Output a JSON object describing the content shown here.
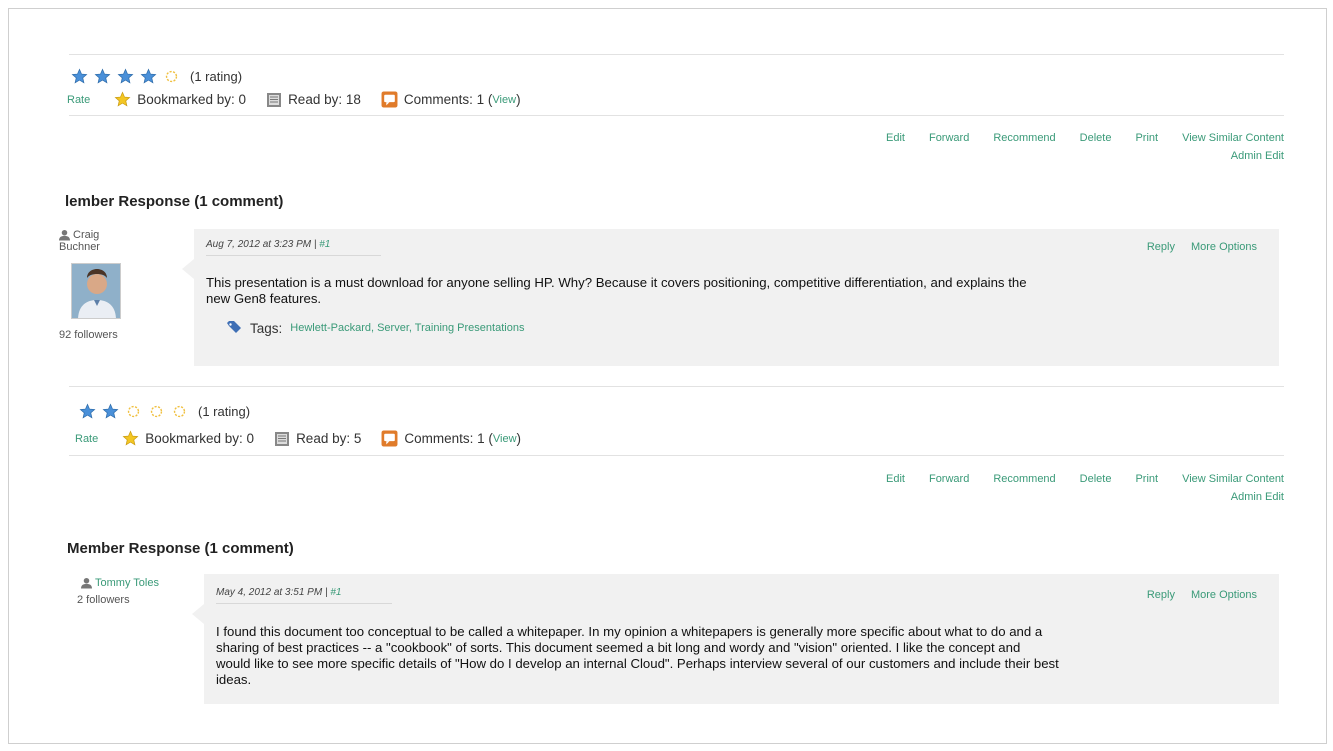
{
  "colors": {
    "link": "#3a9a78",
    "bubble": "#f1f1f1",
    "star_filled": "#4a90d9",
    "star_empty": "#f0c040"
  },
  "items": [
    {
      "stars_filled": 4,
      "stars_total": 5,
      "rating_text": "(1 rating)",
      "rate_label": "Rate",
      "bookmarked_label": "Bookmarked by: 0",
      "read_label": "Read by: 18",
      "comments_label": "Comments: 1 (",
      "view_label": "View",
      "comments_close": ")",
      "actions": [
        "Edit",
        "Forward",
        "Recommend",
        "Delete",
        "Print",
        "View Similar Content"
      ],
      "admin_edit": "Admin Edit",
      "section_title": "lember Response (1 comment)",
      "author_first": "Craig",
      "author_last": "Buchner",
      "followers": "92 followers",
      "date": "Aug 7, 2012 at 3:23 PM",
      "separator": "|",
      "comment_num": "#1",
      "reply": "Reply",
      "more_options": "More Options",
      "body_lines": [
        "This presentation is a must download for anyone selling HP.  Why?  Because it covers positioning, competitive differentiation, and explains the",
        "new Gen8 features."
      ],
      "tags_label": "Tags:",
      "tags": "Hewlett-Packard, Server, Training Presentations"
    },
    {
      "stars_filled": 2,
      "stars_total": 5,
      "rating_text": "(1 rating)",
      "rate_label": "Rate",
      "bookmarked_label": "Bookmarked by: 0",
      "read_label": "Read by: 5",
      "comments_label": "Comments: 1 (",
      "view_label": "View",
      "comments_close": ")",
      "actions": [
        "Edit",
        "Forward",
        "Recommend",
        "Delete",
        "Print",
        "View Similar Content"
      ],
      "admin_edit": "Admin Edit",
      "section_title": "Member Response (1 comment)",
      "author_name": "Tommy Toles",
      "followers": "2 followers",
      "date": "May 4, 2012 at 3:51 PM",
      "separator": "|",
      "comment_num": "#1",
      "reply": "Reply",
      "more_options": "More Options",
      "body_lines": [
        "I found this document too conceptual to be called a whitepaper.  In my opinion a whitepapers is generally more specific about what to do and a",
        "sharing of best practices -- a \"cookbook\" of sorts.  This document seemed a bit long and wordy and \"vision\" oriented.  I like the concept and",
        "would like to see more specific details of \"How do I develop an internal Cloud\".  Perhaps interview several of our customers and include their best",
        "ideas."
      ]
    }
  ]
}
